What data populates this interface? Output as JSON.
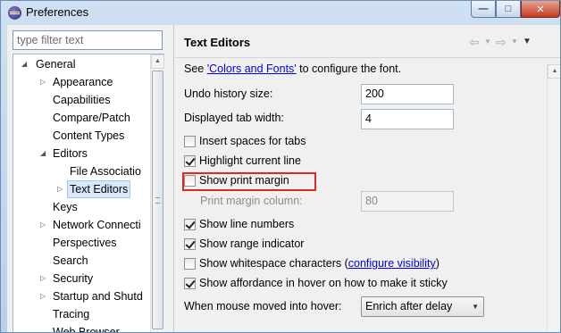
{
  "window": {
    "title": "Preferences",
    "buttons": {
      "minimize": "—",
      "maximize": "□",
      "close": "✕"
    }
  },
  "left": {
    "filter_placeholder": "type filter text",
    "tree": [
      {
        "label": "General",
        "expanded": true,
        "level": 0
      },
      {
        "label": "Appearance",
        "level": 1,
        "expandable": true
      },
      {
        "label": "Capabilities",
        "level": 1
      },
      {
        "label": "Compare/Patch",
        "level": 1
      },
      {
        "label": "Content Types",
        "level": 1
      },
      {
        "label": "Editors",
        "expanded": true,
        "level": 1
      },
      {
        "label": "File Associatio",
        "level": 2
      },
      {
        "label": "Text Editors",
        "level": 2,
        "expandable": true,
        "selected": true
      },
      {
        "label": "Keys",
        "level": 1
      },
      {
        "label": "Network Connecti",
        "level": 1,
        "expandable": true
      },
      {
        "label": "Perspectives",
        "level": 1
      },
      {
        "label": "Search",
        "level": 1
      },
      {
        "label": "Security",
        "level": 1,
        "expandable": true
      },
      {
        "label": "Startup and Shutd",
        "level": 1,
        "expandable": true
      },
      {
        "label": "Tracing",
        "level": 1
      },
      {
        "label": "Web Browser",
        "level": 1
      }
    ]
  },
  "right": {
    "title": "Text Editors",
    "icons": [
      "back-icon",
      "back-menu-icon",
      "forward-icon",
      "forward-menu-icon",
      "view-menu-icon"
    ],
    "see_text_prefix": "See ",
    "see_link": "'Colors and Fonts'",
    "see_text_suffix": " to configure the font.",
    "undo_label": "Undo history size:",
    "undo_value": "200",
    "tab_label": "Displayed tab width:",
    "tab_value": "4",
    "options": {
      "insert_spaces": {
        "label": "Insert spaces for tabs",
        "checked": false
      },
      "highlight_line": {
        "label": "Highlight current line",
        "checked": true
      },
      "print_margin": {
        "label": "Show print margin",
        "checked": false
      },
      "line_numbers": {
        "label": "Show line numbers",
        "checked": true
      },
      "range_indicator": {
        "label": "Show range indicator",
        "checked": true
      },
      "whitespace": {
        "label": "Show whitespace characters (",
        "link": "configure visibility",
        "suffix": ")",
        "checked": false
      },
      "affordance": {
        "label": "Show affordance in hover on how to make it sticky",
        "checked": true
      }
    },
    "print_margin_column_label": "Print margin column:",
    "print_margin_column_value": "80",
    "hover_label": "When mouse moved into hover:",
    "hover_value": "Enrich after delay",
    "highlight_color": "#d92a2a"
  }
}
